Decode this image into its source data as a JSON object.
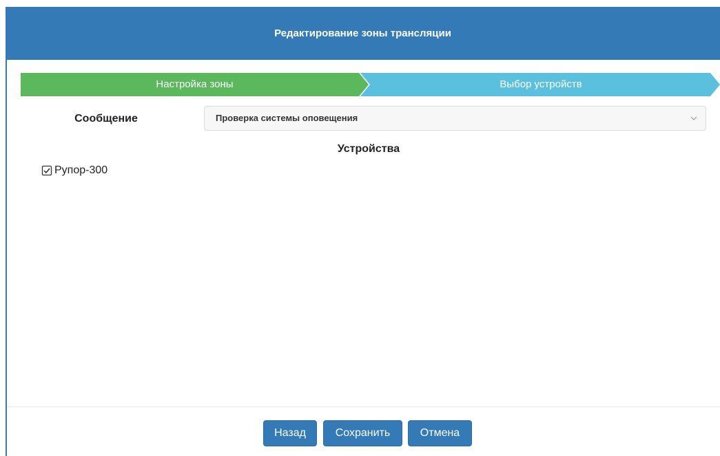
{
  "dialog": {
    "title": "Редактирование зоны трансляции"
  },
  "wizard": {
    "steps": [
      {
        "label": "Настройка зоны",
        "color": "#5cb85c",
        "state": "completed"
      },
      {
        "label": "Выбор устройств",
        "color": "#5bc0de",
        "state": "active"
      }
    ]
  },
  "form": {
    "message_label": "Сообщение",
    "message_value": "Проверка системы оповещения",
    "dropdown_icon": "chevron-down-icon"
  },
  "devices": {
    "title": "Устройства",
    "items": [
      {
        "label": "Рупор-300",
        "checked": true
      }
    ]
  },
  "footer": {
    "back_label": "Назад",
    "save_label": "Сохранить",
    "cancel_label": "Отмена"
  },
  "colors": {
    "primary": "#337ab7",
    "step_done": "#5cb85c",
    "step_active": "#5bc0de"
  }
}
